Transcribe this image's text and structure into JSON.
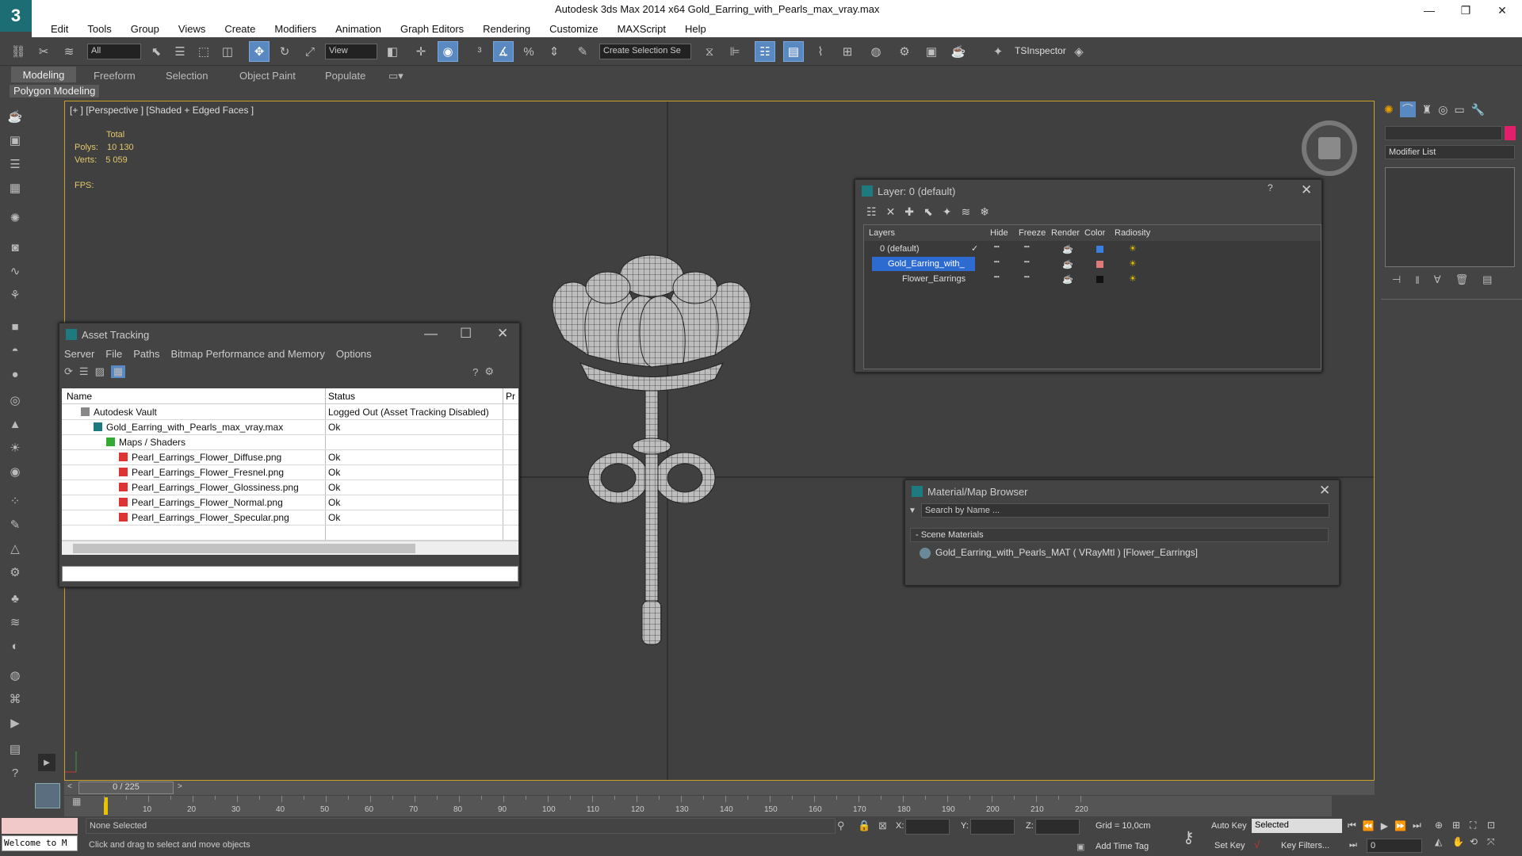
{
  "app": {
    "title": "Autodesk 3ds Max  2014 x64    Gold_Earring_with_Pearls_max_vray.max"
  },
  "menu": [
    "Edit",
    "Tools",
    "Group",
    "Views",
    "Create",
    "Modifiers",
    "Animation",
    "Graph Editors",
    "Rendering",
    "Customize",
    "MAXScript",
    "Help"
  ],
  "toolbar": {
    "selection_filter": "All",
    "ref_coord": "View",
    "named_selection": "Create Selection Se",
    "tsinspector": "TSInspector"
  },
  "ribbon": {
    "tabs": [
      "Modeling",
      "Freeform",
      "Selection",
      "Object Paint",
      "Populate"
    ],
    "panel": "Polygon Modeling"
  },
  "viewport": {
    "label": "[+ ] [Perspective ] [Shaded + Edged Faces ]",
    "stats": {
      "total": "Total",
      "polys_label": "Polys:",
      "polys": "10 130",
      "verts_label": "Verts:",
      "verts": "5 059",
      "fps_label": "FPS:"
    }
  },
  "asset_tracking": {
    "title": "Asset Tracking",
    "menu": [
      "Server",
      "File",
      "Paths",
      "Bitmap Performance and Memory",
      "Options"
    ],
    "columns": [
      "Name",
      "Status",
      "Pr"
    ],
    "rows": [
      {
        "name": "Autodesk Vault",
        "status": "Logged Out (Asset Tracking Disabled)"
      },
      {
        "name": "Gold_Earring_with_Pearls_max_vray.max",
        "status": "Ok"
      },
      {
        "name": "Maps / Shaders",
        "status": ""
      },
      {
        "name": "Pearl_Earrings_Flower_Diffuse.png",
        "status": "Ok"
      },
      {
        "name": "Pearl_Earrings_Flower_Fresnel.png",
        "status": "Ok"
      },
      {
        "name": "Pearl_Earrings_Flower_Glossiness.png",
        "status": "Ok"
      },
      {
        "name": "Pearl_Earrings_Flower_Normal.png",
        "status": "Ok"
      },
      {
        "name": "Pearl_Earrings_Flower_Specular.png",
        "status": "Ok"
      }
    ]
  },
  "layer": {
    "title": "Layer: 0 (default)",
    "columns": [
      "Layers",
      "Hide",
      "Freeze",
      "Render",
      "Color",
      "Radiosity"
    ],
    "rows": [
      {
        "name": "0 (default)",
        "color": "#3a7fe0"
      },
      {
        "name": "Gold_Earring_with_",
        "color": "#e07a7a"
      },
      {
        "name": "Flower_Earrings",
        "color": "#111111"
      }
    ]
  },
  "material_browser": {
    "title": "Material/Map Browser",
    "search_placeholder": "Search by Name ...",
    "section": "- Scene Materials",
    "item": "Gold_Earring_with_Pearls_MAT  ( VRayMtl )  [Flower_Earrings]"
  },
  "command_panel": {
    "modifier_list": "Modifier List"
  },
  "timeline": {
    "frame": "0 / 225",
    "ticks": [
      "10",
      "20",
      "30",
      "40",
      "50",
      "60",
      "70",
      "80",
      "90",
      "100",
      "110",
      "120",
      "130",
      "140",
      "150",
      "160",
      "170",
      "180",
      "190",
      "200",
      "210",
      "220"
    ]
  },
  "status": {
    "maxscript": "Welcome to M",
    "selection": "None Selected",
    "prompt": "Click and drag to select and move objects",
    "x_label": "X:",
    "y_label": "Y:",
    "z_label": "Z:",
    "grid": "Grid = 10,0cm",
    "add_time_tag": "Add Time Tag",
    "auto_key": "Auto Key",
    "set_key": "Set Key",
    "key_mode": "Selected",
    "key_filters": "Key Filters...",
    "frame_field": "0"
  }
}
